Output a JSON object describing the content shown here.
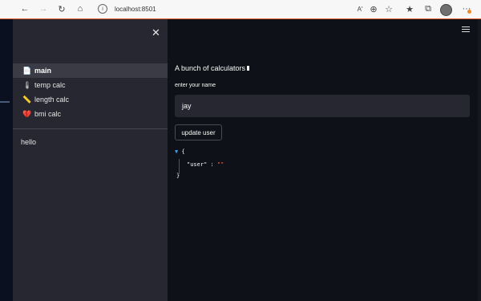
{
  "browser": {
    "url": "localhost:8501",
    "icons": [
      "back-icon",
      "forward-icon",
      "reload-icon",
      "home-icon",
      "info-icon",
      "read-aloud-icon",
      "zoom-icon",
      "favorite-add-icon",
      "favorites-icon",
      "collections-icon",
      "profile-icon",
      "more-icon"
    ],
    "accent_color": "#e05a2a"
  },
  "sidebar": {
    "close_icon": "close-icon",
    "items": [
      {
        "icon": "📄",
        "label": "main",
        "active": true
      },
      {
        "icon": "🌡",
        "label": "temp calc",
        "active": false
      },
      {
        "icon": "📏",
        "label": "length calc",
        "active": false
      },
      {
        "icon": "💔",
        "label": "bmi calc",
        "active": false
      }
    ],
    "footer_text": "hello"
  },
  "main": {
    "title": "A bunch of calculators",
    "name_label": "enter your name",
    "name_value": "jay",
    "button_label": "update user",
    "json_open": "{",
    "json_key": "\"user\"",
    "json_colon": ":",
    "json_value": "\"\"",
    "json_close": "}"
  },
  "colors": {
    "sidebar_bg": "#262730",
    "main_bg": "#0e1117",
    "json_value": "#ff6b57"
  }
}
